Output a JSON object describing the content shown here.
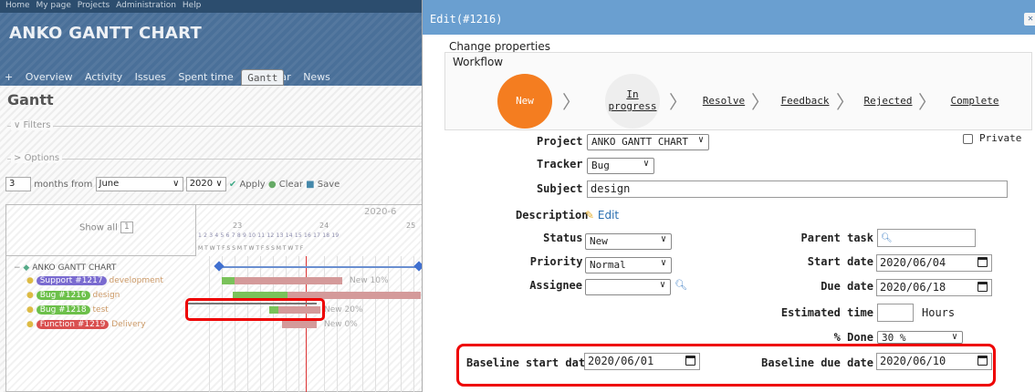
{
  "bg": {
    "top_menu": [
      "Home",
      "My page",
      "Projects",
      "Administration",
      "Help"
    ],
    "project_title": "ANKO GANTT CHART",
    "tabs": [
      "+",
      "Overview",
      "Activity",
      "Issues",
      "Spent time",
      "Gantt",
      "Calendar",
      "News"
    ],
    "selected_tab": "Gantt",
    "page_title": "Gantt",
    "filters_label": "Filters",
    "options_label": "Options",
    "months_value": "3",
    "months_from_label": "months from",
    "month_value": "June",
    "year_value": "2020",
    "apply_label": "Apply",
    "clear_label": "Clear",
    "save_label": "Save",
    "show_all_label": "Show all",
    "show_all_count": "1",
    "gantt_month": "2020-6",
    "weeks": [
      "23",
      "24",
      "25"
    ],
    "days_text": "1 2 3 4 5 6 7 8 9 10 11 12 13 14 15 16 17 18 19",
    "dows_text": "M T W T F S S M T W T F S S M T W T F",
    "project_row": "ANKO GANTT CHART",
    "issues": [
      {
        "tag": "Support #1217",
        "subject": "development",
        "color": "#7a6bd0",
        "status": "New 10%"
      },
      {
        "tag": "Bug #1216",
        "subject": "design",
        "color": "#6cc04a",
        "status": ""
      },
      {
        "tag": "Bug #1218",
        "subject": "test",
        "color": "#6cc04a",
        "status": "New 20%"
      },
      {
        "tag": "Function #1219",
        "subject": "Delivery",
        "color": "#d94f4f",
        "status": "New 0%"
      }
    ]
  },
  "dialog": {
    "title": "Edit(#1216)",
    "close_icon": "close-icon",
    "change_properties": "Change properties",
    "workflow_label": "Workflow",
    "workflow_steps": [
      "New",
      "In progress",
      "Resolve",
      "Feedback",
      "Rejected",
      "Complete"
    ],
    "accent_color": "#f47d20",
    "form": {
      "project_label": "Project",
      "project_value": "ANKO GANTT CHART",
      "private_label": "Private",
      "private_checked": false,
      "tracker_label": "Tracker",
      "tracker_value": "Bug",
      "subject_label": "Subject",
      "subject_value": "design",
      "description_label": "Description",
      "description_edit": "Edit",
      "status_label": "Status",
      "status_value": "New",
      "priority_label": "Priority",
      "priority_value": "Normal",
      "assignee_label": "Assignee",
      "assignee_value": "",
      "parent_task_label": "Parent task",
      "parent_task_value": "",
      "start_date_label": "Start date",
      "start_date_value": "2020/06/04",
      "due_date_label": "Due date",
      "due_date_value": "2020/06/18",
      "estimated_time_label": "Estimated time",
      "estimated_time_value": "",
      "hours_label": "Hours",
      "done_label": "% Done",
      "done_value": "30 %",
      "baseline_start_label": "Baseline start date",
      "baseline_start_value": "2020/06/01",
      "baseline_due_label": "Baseline due date",
      "baseline_due_value": "2020/06/10"
    }
  }
}
